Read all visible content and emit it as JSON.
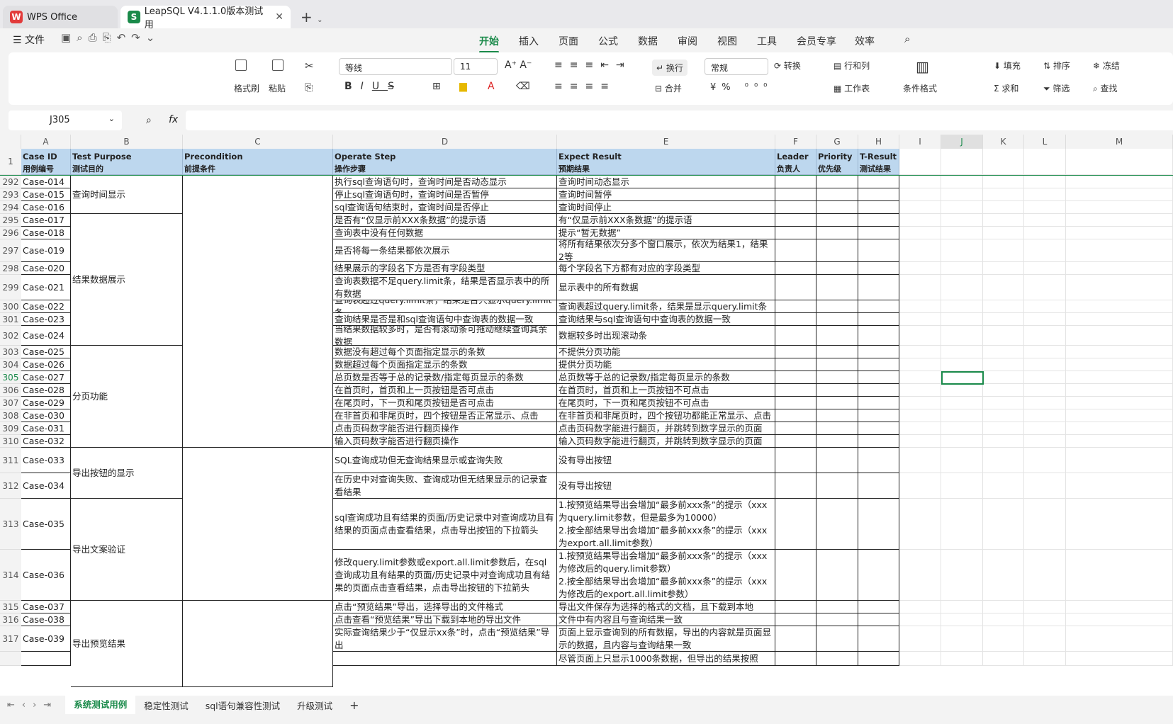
{
  "app": {
    "wps_tab": "WPS Office",
    "doc_tab": "LeapSQL V4.1.1.0版本测试用"
  },
  "menu": {
    "file": "文件",
    "tabs": [
      "开始",
      "插入",
      "页面",
      "公式",
      "数据",
      "审阅",
      "视图",
      "工具",
      "会员专享",
      "效率"
    ]
  },
  "ribbon": {
    "format_painter": "格式刷",
    "paste": "粘贴",
    "font": "等线",
    "font_size": "11",
    "wrap": "换行",
    "number_format": "常规",
    "convert": "转换",
    "row_col": "行和列",
    "worksheet": "工作表",
    "merge": "合并",
    "cond_format": "条件格式",
    "fill": "填充",
    "sort": "排序",
    "freeze": "冻结",
    "sum": "求和",
    "filter": "筛选",
    "find": "查找"
  },
  "formula": {
    "cell_ref": "J305",
    "fx": "fx"
  },
  "columns": [
    "A",
    "B",
    "C",
    "D",
    "E",
    "F",
    "G",
    "H",
    "I",
    "J",
    "K",
    "L",
    "M"
  ],
  "header": {
    "a1": "Case ID",
    "a2": "用例编号",
    "b1": "Test Purpose",
    "b2": "测试目的",
    "c1": "Precondition",
    "c2": "前提条件",
    "d1": "Operate Step",
    "d2": "操作步骤",
    "e1": "Expect Result",
    "e2": "预期结果",
    "f1": "Leader",
    "f2": "负责人",
    "g1": "Priority",
    "g2": "优先级",
    "h1": "T-Result",
    "h2": "测试结果"
  },
  "purposes": [
    "查询时间显示",
    "结果数据展示",
    "分页功能",
    "导出按钮的显示",
    "导出文案验证",
    "导出预览结果"
  ],
  "rows": [
    {
      "n": "292",
      "id": "Case-014",
      "step": "执行sql查询语句时，查询时间是否动态显示",
      "exp": "查询时间动态显示"
    },
    {
      "n": "293",
      "id": "Case-015",
      "step": "停止sql查询语句时，查询时间是否暂停",
      "exp": "查询时间暂停"
    },
    {
      "n": "294",
      "id": "Case-016",
      "step": "sql查询语句结束时，查询时间是否停止",
      "exp": "查询时间停止"
    },
    {
      "n": "295",
      "id": "Case-017",
      "step": "是否有“仅显示前XXX条数据”的提示语",
      "exp": "有“仅显示前XXX条数据”的提示语"
    },
    {
      "n": "296",
      "id": "Case-018",
      "step": "查询表中没有任何数据",
      "exp": "提示“暂无数据”"
    },
    {
      "n": "297",
      "id": "Case-019",
      "step": "是否将每一条结果都依次展示",
      "exp": "将所有结果依次分多个窗口展示，依次为结果1，结果2等"
    },
    {
      "n": "298",
      "id": "Case-020",
      "step": "结果展示的字段名下方是否有字段类型",
      "exp": "每个字段名下方都有对应的字段类型"
    },
    {
      "n": "299",
      "id": "Case-021",
      "step": "查询表数据不足query.limit条，结果是否显示表中的所有数据",
      "exp": "显示表中的所有数据"
    },
    {
      "n": "300",
      "id": "Case-022",
      "step": "查询表超过query.limit条，结果是否只显示query.limit条",
      "exp": "查询表超过query.limit条，结果是显示query.limit条"
    },
    {
      "n": "301",
      "id": "Case-023",
      "step": "查询结果是否是和sql查询语句中查询表的数据一致",
      "exp": "查询结果与sql查询语句中查询表的数据一致"
    },
    {
      "n": "302",
      "id": "Case-024",
      "step": "当结果数据较多时，是否有滚动条可拖动继续查询其余数据",
      "exp": "数据较多时出现滚动条"
    },
    {
      "n": "303",
      "id": "Case-025",
      "step": "数据没有超过每个页面指定显示的条数",
      "exp": "不提供分页功能"
    },
    {
      "n": "304",
      "id": "Case-026",
      "step": "数据超过每个页面指定显示的条数",
      "exp": "提供分页功能"
    },
    {
      "n": "305",
      "id": "Case-027",
      "step": "总页数是否等于总的记录数/指定每页显示的条数",
      "exp": "总页数等于总的记录数/指定每页显示的条数"
    },
    {
      "n": "306",
      "id": "Case-028",
      "step": "在首页时，首页和上一页按钮是否可点击",
      "exp": "在首页时，首页和上一页按钮不可点击"
    },
    {
      "n": "307",
      "id": "Case-029",
      "step": "在尾页时，下一页和尾页按钮是否可点击",
      "exp": "在尾页时，下一页和尾页按钮不可点击"
    },
    {
      "n": "308",
      "id": "Case-030",
      "step": "在非首页和非尾页时，四个按钮是否正常显示、点击",
      "exp": "在非首页和非尾页时，四个按钮功都能正常显示、点击"
    },
    {
      "n": "309",
      "id": "Case-031",
      "step": "点击页码数字能否进行翻页操作",
      "exp": "点击页码数字能进行翻页，并跳转到数字显示的页面"
    },
    {
      "n": "310",
      "id": "Case-032",
      "step": "输入页码数字能否进行翻页操作",
      "exp": "输入页码数字能进行翻页，并跳转到数字显示的页面"
    },
    {
      "n": "311",
      "id": "Case-033",
      "step": "SQL查询成功但无查询结果显示或查询失败",
      "exp": "没有导出按钮"
    },
    {
      "n": "312",
      "id": "Case-034",
      "step": "在历史中对查询失败、查询成功但无结果显示的记录查看结果",
      "exp": "没有导出按钮"
    },
    {
      "n": "313",
      "id": "Case-035",
      "step": "sql查询成功且有结果的页面/历史记录中对查询成功且有结果的页面点击查看结果，点击导出按钮的下拉箭头",
      "exp": "1.按预览结果导出会增加“最多前xxx条”的提示（xxx为query.limit参数，但是最多为10000）\n2.按全部结果导出会增加“最多前xxx条”的提示（xxx为export.all.limit参数）"
    },
    {
      "n": "314",
      "id": "Case-036",
      "step": "修改query.limit参数或export.all.limit参数后，在sql查询成功且有结果的页面/历史记录中对查询成功且有结果的页面点击查看结果，点击导出按钮的下拉箭头",
      "exp": "1.按预览结果导出会增加“最多前xxx条”的提示（xxx为修改后的query.limit参数）\n2.按全部结果导出会增加“最多前xxx条”的提示（xxx为修改后的export.all.limit参数）"
    },
    {
      "n": "315",
      "id": "Case-037",
      "step": "点击“预览结果”导出，选择导出的文件格式",
      "exp": "导出文件保存为选择的格式的文档，且下载到本地"
    },
    {
      "n": "316",
      "id": "Case-038",
      "step": "点击查看“预览结果”导出下载到本地的导出文件",
      "exp": "文件中有内容且与查询结果一致"
    },
    {
      "n": "317",
      "id": "Case-039",
      "step": "实际查询结果少于“仅显示xx条”时，点击“预览结果”导出",
      "exp": "页面上显示查询到的所有数据，导出的内容就是页面显示的数据，且内容与查询结果一致"
    },
    {
      "n": "",
      "id": "",
      "step": "",
      "exp": "尽管页面上只显示1000条数据，但导出的结果按照"
    }
  ],
  "sheets": [
    "系统测试用例",
    "稳定性测试",
    "sql语句兼容性测试",
    "升级测试"
  ],
  "colors": {
    "accent": "#1a8a4a",
    "header_fill": "#bdd7ee"
  }
}
